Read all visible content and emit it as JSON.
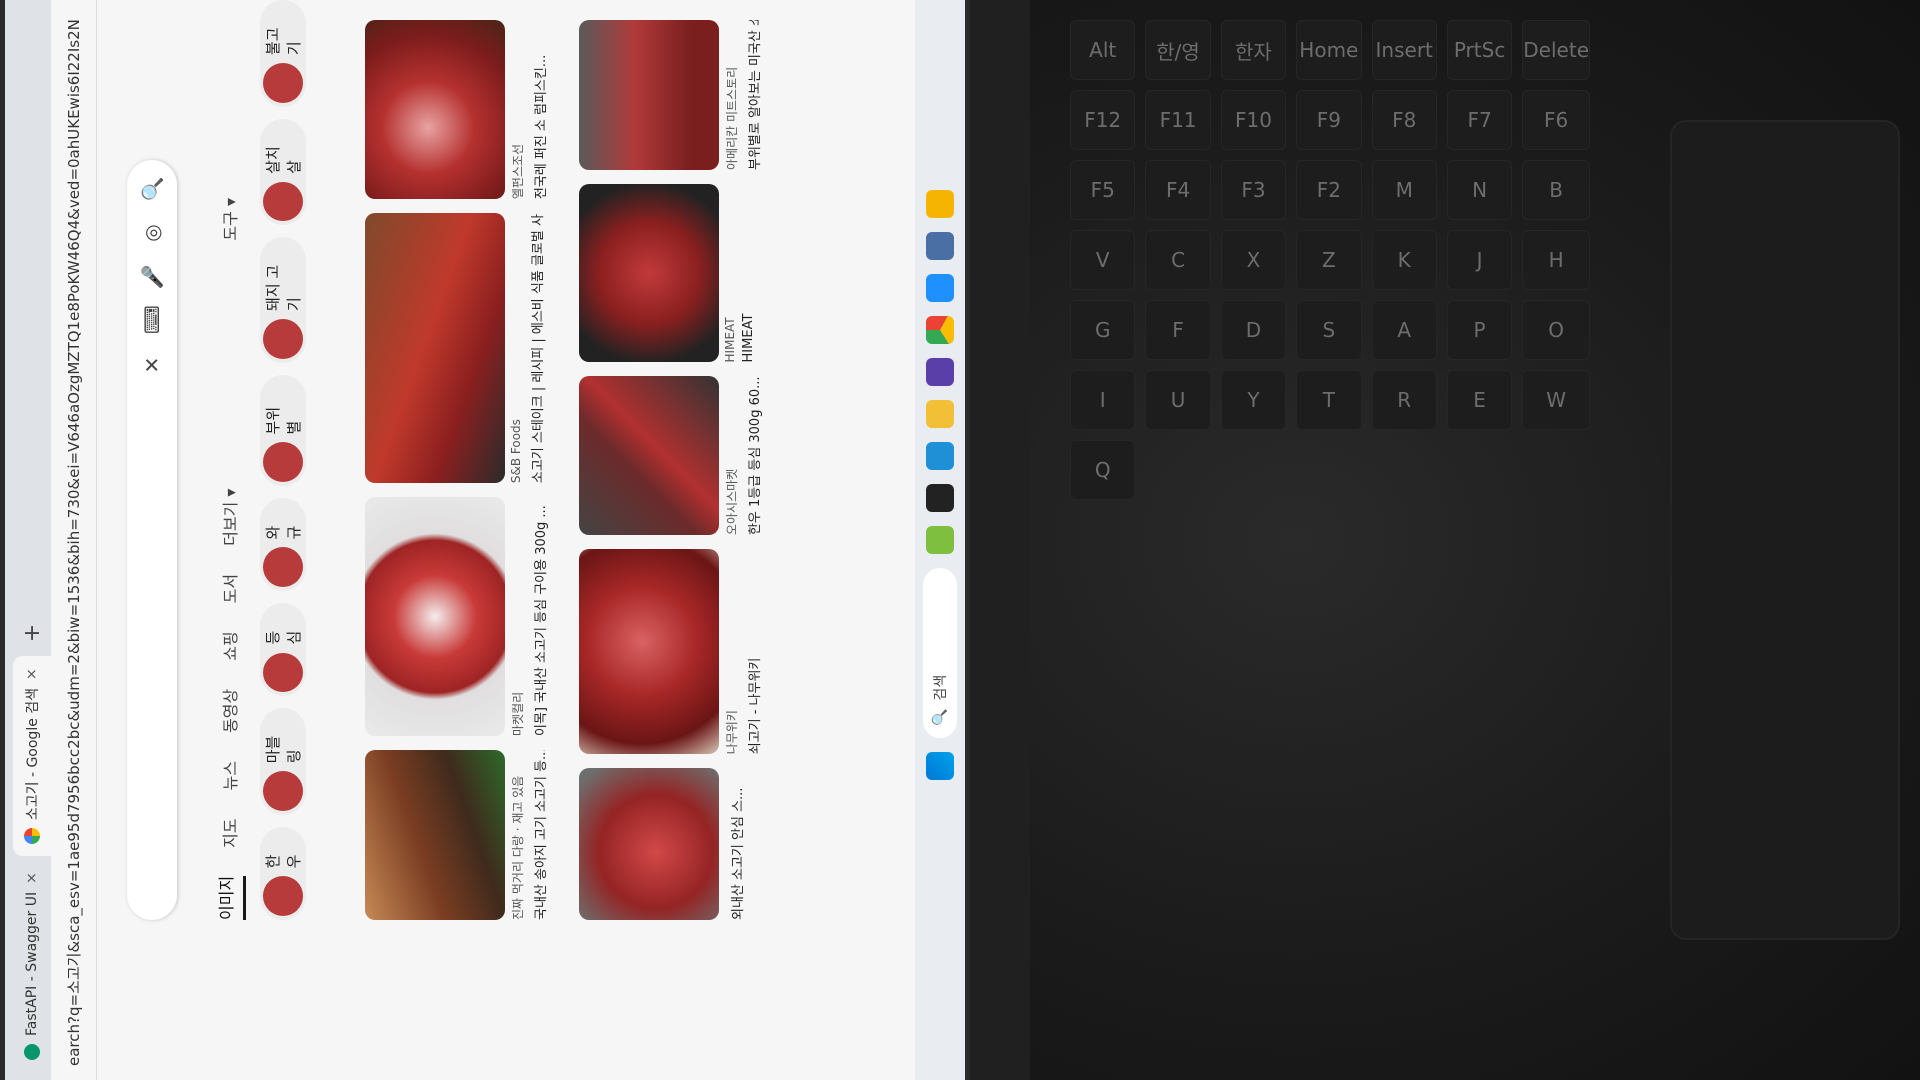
{
  "browser": {
    "tabs": [
      {
        "title": "FastAPI - Swagger UI",
        "close": "×"
      },
      {
        "title": "소고기 - Google 검색",
        "close": "×"
      }
    ],
    "new_tab": "+",
    "url": "earch?q=소고기&sca_esv=1ae95d7956bcc2bc&udm=2&biw=1536&bih=730&ei=V646aOzgMZTQ1e8PoKW46Q4&ved=0ahUKEwis6I22Is2N"
  },
  "search": {
    "query": "",
    "close_icon": "✕",
    "keyboard_icon": "⌨",
    "mic_icon": "🎤",
    "lens_icon": "◎",
    "search_icon": "🔍"
  },
  "nav_tabs": {
    "images": "이미지",
    "maps": "지도",
    "news": "뉴스",
    "videos": "동영상",
    "shopping": "쇼핑",
    "books": "도서",
    "more": "더보기 ▾",
    "tools": "도구 ▾"
  },
  "chips": [
    "한우",
    "마블링",
    "등심",
    "와규",
    "부위 별",
    "돼지 고기",
    "살치살",
    "불고기"
  ],
  "results": [
    {
      "source": "진짜 먹거리 다랑 · 재고 있음",
      "caption": "국내산 송아지 고기 소고기 등..."
    },
    {
      "source": "마켓컬리",
      "caption": "이목] 국내산 소고기 등심 구이용 300g ..."
    },
    {
      "source": "S&B Foods",
      "caption": "소고기 스테이크 | 레시피 | 에스비 식품 글로벌 사..."
    },
    {
      "source": "엘펀스조선",
      "caption": "전국레 퍼진 소 럼피스킨..."
    },
    {
      "source": "",
      "caption": "외내산 소고기 안심 스..."
    },
    {
      "source": "나무위키",
      "caption": "쇠고기 - 나무위키"
    },
    {
      "source": "오아시스마켓",
      "caption": "한우 1등급 등심 300g 60..."
    },
    {
      "source": "HIMEAT",
      "caption": "HIMEAT"
    },
    {
      "source": "아메리칸 미트스토리",
      "caption": "부위별로 알아보는 미국산 소고..."
    }
  ],
  "taskbar": {
    "search_label": "검색"
  },
  "keyboard": {
    "keys": [
      "Alt",
      "한/영",
      "한자",
      "Home",
      "Insert",
      "PrtSc",
      "Delete",
      "F12",
      "F11",
      "F10",
      "F9",
      "F8",
      "F7",
      "F6",
      "F5",
      "F4",
      "F3",
      "F2",
      "M",
      "N",
      "B",
      "V",
      "C",
      "X",
      "Z",
      "K",
      "J",
      "H",
      "G",
      "F",
      "D",
      "S",
      "A",
      "P",
      "O",
      "I",
      "U",
      "Y",
      "T",
      "R",
      "E",
      "W",
      "Q"
    ]
  }
}
